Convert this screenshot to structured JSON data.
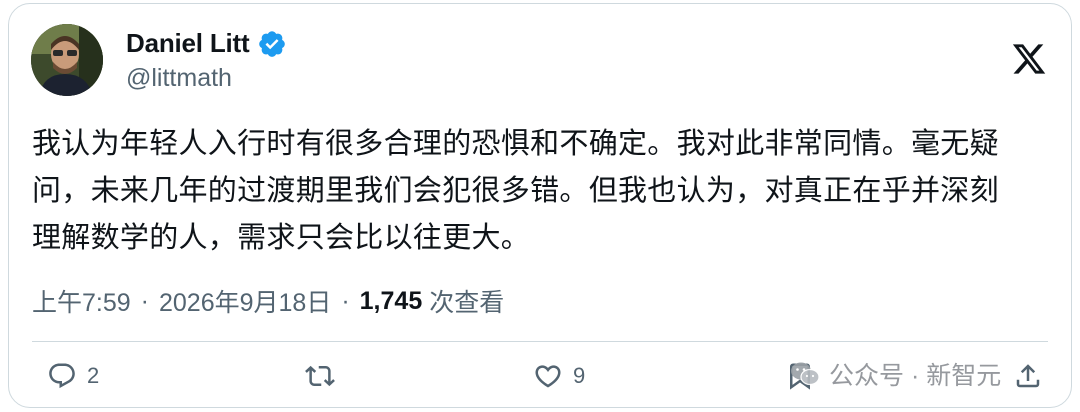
{
  "author": {
    "display_name": "Daniel Litt",
    "handle": "@littmath",
    "verified": true
  },
  "tweet": {
    "lines": [
      "我认为年轻人入行时有很多合理的恐惧和不确定。我对此非常同情。毫无疑",
      "问，未来几年的过渡期里我们会犯很多错。但我也认为，对真正在乎并深刻",
      "理解数学的人，需求只会比以往更大。"
    ]
  },
  "meta": {
    "time": "上午7:59",
    "separator": "·",
    "date": "2026年9月18日",
    "views_count": "1,745",
    "views_label": "次查看"
  },
  "actions": {
    "reply_count": "2",
    "retweet_count": "",
    "like_count": "9"
  },
  "watermark": {
    "text": "公众号 · 新智元"
  },
  "icons": {
    "platform": "x-logo-icon",
    "verified": "verified-badge-icon",
    "reply": "reply-icon",
    "retweet": "retweet-icon",
    "like": "heart-icon",
    "bookmark": "bookmark-icon",
    "share": "share-icon"
  },
  "colors": {
    "text_primary": "#0f1419",
    "text_secondary": "#536471",
    "verified_blue": "#1d9bf0",
    "border": "#cfd9de"
  }
}
